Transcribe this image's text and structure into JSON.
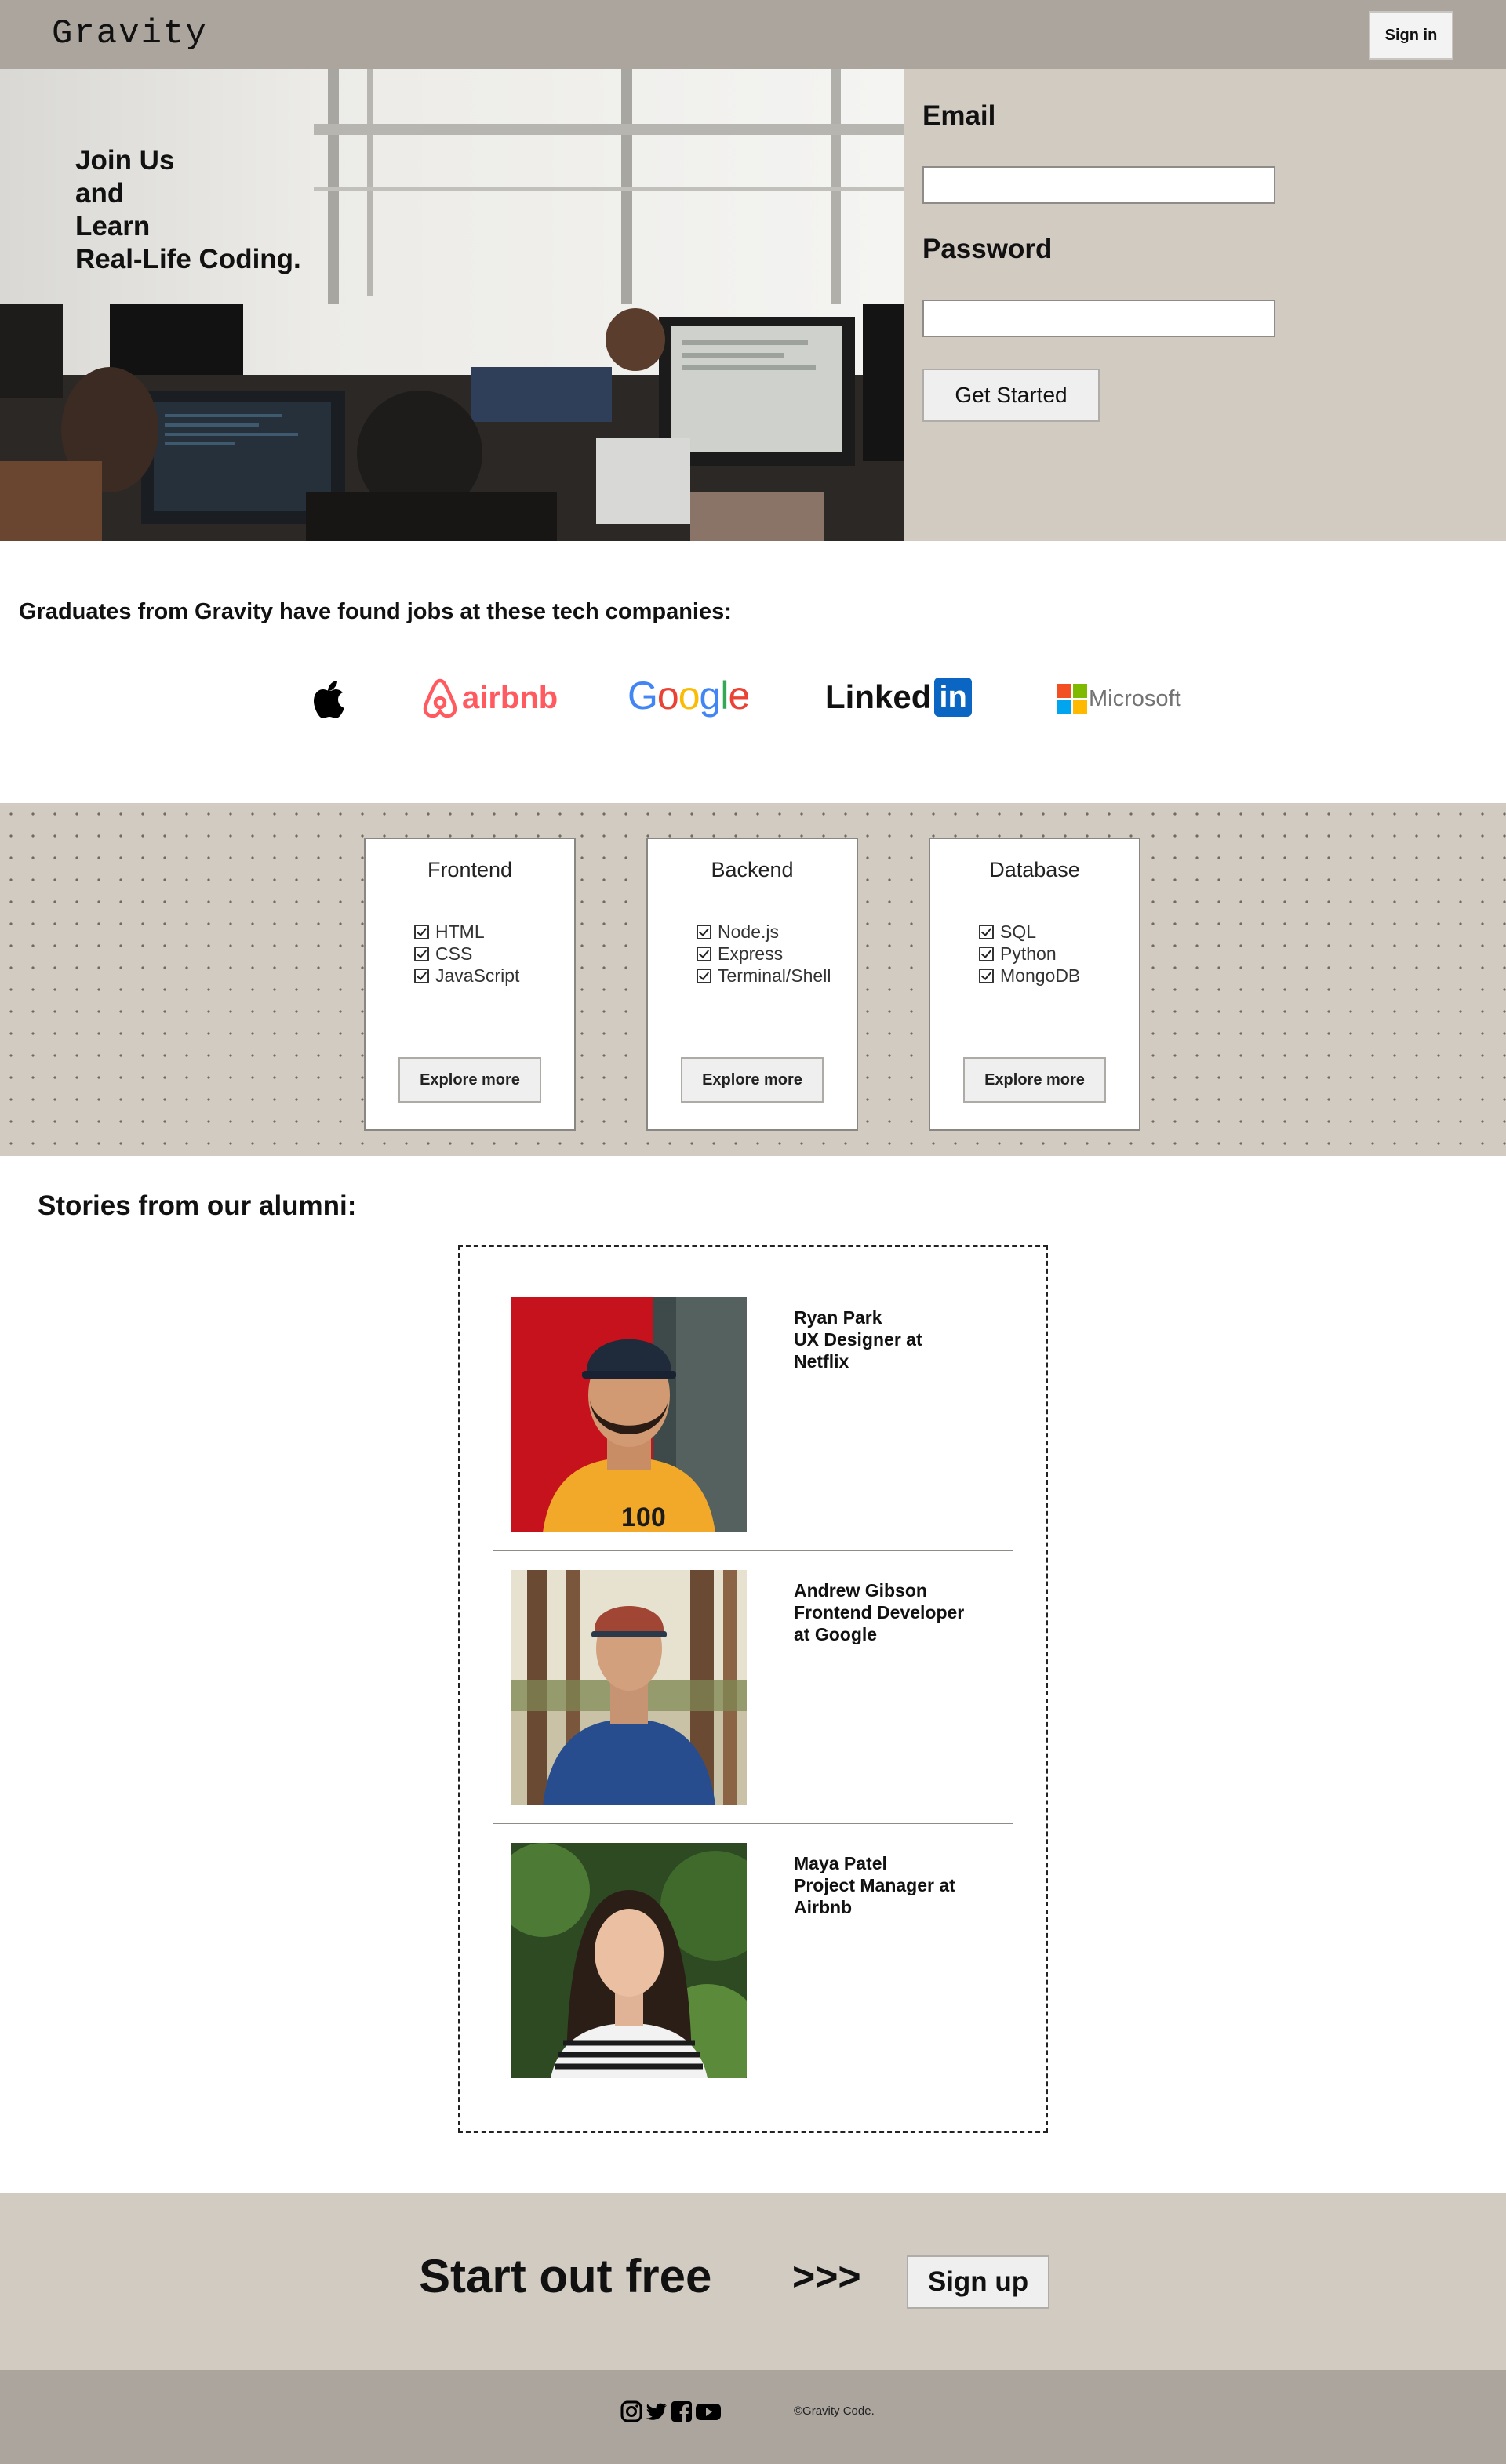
{
  "header": {
    "logo": "Gravity",
    "signin_label": "Sign in"
  },
  "hero": {
    "title_lines": [
      "Join Us",
      "and",
      "Learn",
      "Real-Life Coding."
    ],
    "form": {
      "email_label": "Email",
      "email_value": "",
      "password_label": "Password",
      "password_value": "",
      "submit_label": "Get Started"
    }
  },
  "companies": {
    "heading": "Graduates from Gravity have found jobs at these tech companies:",
    "logos": [
      {
        "name": "Apple",
        "icon": "apple-logo",
        "text": ""
      },
      {
        "name": "Airbnb",
        "icon": "airbnb-logo",
        "text": "airbnb",
        "color": "#ff5a5f"
      },
      {
        "name": "Google",
        "icon": "google-logo",
        "text": "Google"
      },
      {
        "name": "LinkedIn",
        "icon": "linkedin-logo",
        "text": "Linked",
        "badge": "in",
        "color": "#0a66c2"
      },
      {
        "name": "Microsoft",
        "icon": "microsoft-logo",
        "text": "Microsoft"
      }
    ]
  },
  "courses": [
    {
      "title": "Frontend",
      "items": [
        "HTML",
        "CSS",
        "JavaScript"
      ],
      "button": "Explore more"
    },
    {
      "title": "Backend",
      "items": [
        "Node.js",
        "Express",
        "Terminal/Shell"
      ],
      "button": "Explore more"
    },
    {
      "title": "Database",
      "items": [
        "SQL",
        "Python",
        "MongoDB"
      ],
      "button": "Explore more"
    }
  ],
  "stories": {
    "heading": "Stories from our alumni:",
    "items": [
      {
        "lines": [
          "Ryan Park",
          "UX Designer at",
          "Netflix"
        ]
      },
      {
        "lines": [
          "Andrew Gibson",
          "Frontend Developer",
          "at Google"
        ]
      },
      {
        "lines": [
          "Maya Patel",
          "Project Manager at",
          "Airbnb"
        ]
      }
    ]
  },
  "cta": {
    "text": "Start out free",
    "arrows": ">>>",
    "button": "Sign up"
  },
  "footer": {
    "social_icons": [
      "instagram-icon",
      "twitter-icon",
      "facebook-icon",
      "youtube-icon"
    ],
    "copyright": "©Gravity Code."
  },
  "colors": {
    "header_bg": "#aba59e",
    "panel_bg": "#d2cbc2",
    "airbnb": "#ff5a5f",
    "linkedin": "#0a66c2"
  }
}
